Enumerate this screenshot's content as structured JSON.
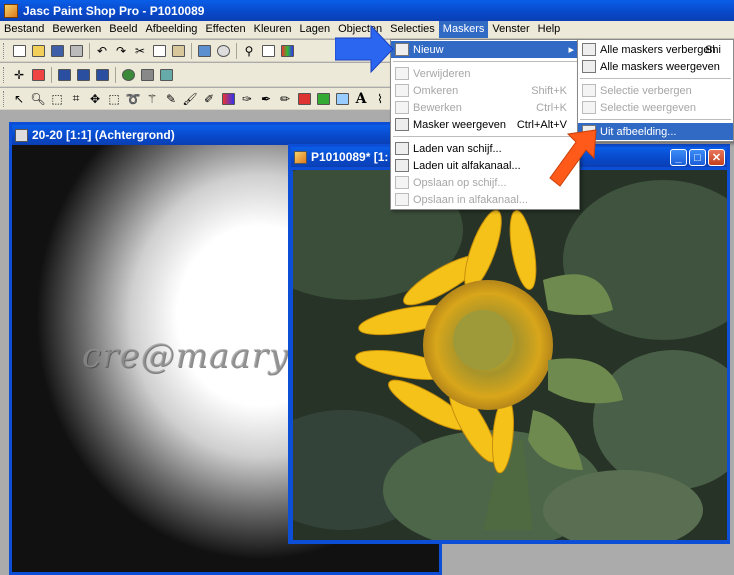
{
  "app": {
    "title": "Jasc Paint Shop Pro - P1010089"
  },
  "menubar": [
    "Bestand",
    "Bewerken",
    "Beeld",
    "Afbeelding",
    "Effecten",
    "Kleuren",
    "Lagen",
    "Objecten",
    "Selecties",
    "Maskers",
    "Venster",
    "Help"
  ],
  "active_menu": "Maskers",
  "maskers_menu": {
    "items": [
      {
        "label": "Nieuw",
        "shortcut": "",
        "enabled": true,
        "highlighted": true,
        "submenu": true
      },
      {
        "label": "Verwijderen",
        "shortcut": "",
        "enabled": false
      },
      {
        "label": "Omkeren",
        "shortcut": "Shift+K",
        "enabled": false
      },
      {
        "label": "Bewerken",
        "shortcut": "Ctrl+K",
        "enabled": false
      },
      {
        "label": "Masker weergeven",
        "shortcut": "Ctrl+Alt+V",
        "enabled": true
      },
      {
        "label": "Laden van schijf...",
        "shortcut": "",
        "enabled": true
      },
      {
        "label": "Laden uit alfakanaal...",
        "shortcut": "",
        "enabled": true
      },
      {
        "label": "Opslaan op schijf...",
        "shortcut": "",
        "enabled": false
      },
      {
        "label": "Opslaan in alfakanaal...",
        "shortcut": "",
        "enabled": false
      }
    ]
  },
  "nieuw_submenu": {
    "items": [
      {
        "label": "Alle maskers verbergen",
        "shortcut": "Shi",
        "enabled": true
      },
      {
        "label": "Alle maskers weergeven",
        "shortcut": "",
        "enabled": true
      },
      {
        "label": "Selectie verbergen",
        "shortcut": "",
        "enabled": false
      },
      {
        "label": "Selectie weergeven",
        "shortcut": "",
        "enabled": false
      },
      {
        "label": "Uit afbeelding...",
        "shortcut": "",
        "enabled": true,
        "highlighted": true
      }
    ]
  },
  "mask_window": {
    "title": "20-20 [1:1] (Achtergrond)"
  },
  "photo_window": {
    "title": "P1010089* [1:"
  },
  "watermark": "cre@maaryl...s",
  "colors": {
    "titlebar": "#0a5ee8",
    "menu_highlight": "#316ac5",
    "blue_arrow": "#2a66f0",
    "red_arrow": "#ff5a1a"
  }
}
